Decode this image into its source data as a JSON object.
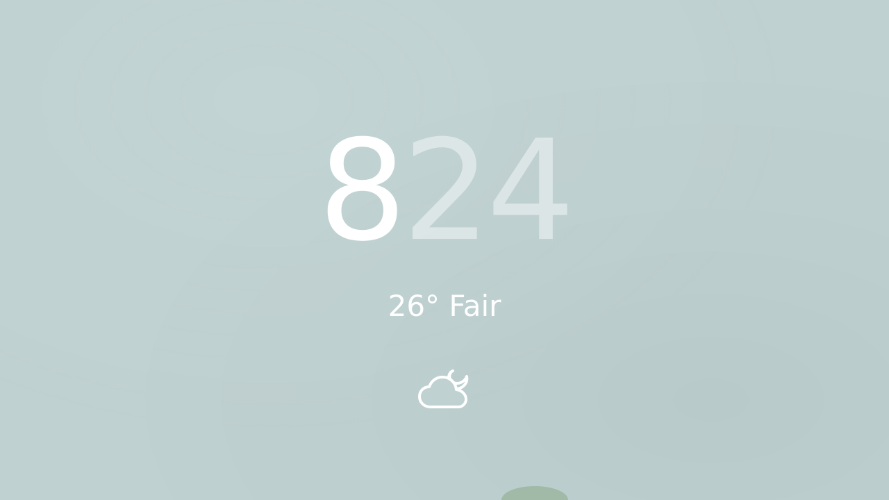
{
  "lockscreen": {
    "clock": {
      "hour": "8",
      "minutes": "24"
    },
    "weather": {
      "temperature": "26°",
      "condition": "Fair",
      "icon": "cloud-moon-icon"
    }
  },
  "colors": {
    "background": "#bfd1d1",
    "text": "#ffffff",
    "plant": "#9fb7a4"
  }
}
